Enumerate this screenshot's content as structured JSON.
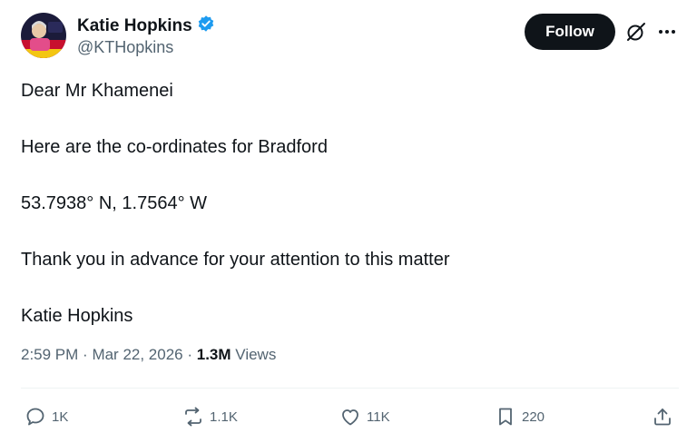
{
  "user": {
    "display_name": "Katie Hopkins",
    "handle": "@KTHopkins",
    "verified_icon": "verified-badge-icon",
    "avatar_icon": "avatar"
  },
  "header": {
    "follow_label": "Follow",
    "grok_icon": "grok-icon",
    "more_icon": "more-icon"
  },
  "tweet": {
    "lines": [
      "Dear Mr Khamenei",
      "Here are the co-ordinates for Bradford",
      "53.7938° N, 1.7564° W",
      "Thank you in advance for your attention to this matter",
      "Katie Hopkins"
    ]
  },
  "meta": {
    "time": "2:59 PM",
    "date": "Mar 22, 2026",
    "views_count": "1.3M",
    "views_label": "Views"
  },
  "actions": {
    "replies": "1K",
    "reposts": "1.1K",
    "likes": "11K",
    "bookmarks": "220"
  },
  "colors": {
    "text": "#0f1419",
    "secondary": "#536471",
    "verified": "#1d9bf0",
    "follow_bg": "#0f1419"
  }
}
